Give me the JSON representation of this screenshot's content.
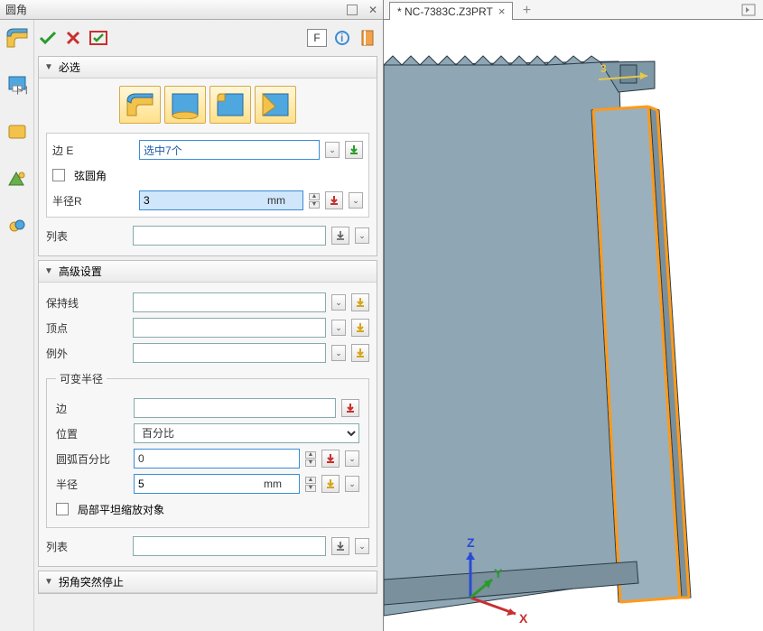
{
  "panel": {
    "title": "圆角"
  },
  "top": {
    "f_button": "F"
  },
  "tab": {
    "title": "* NC-7383C.Z3PRT",
    "close": "×",
    "add": "+"
  },
  "sec_required": {
    "title": "必选"
  },
  "req": {
    "edge_label": "边 E",
    "edge_value": "选中7个",
    "chord_label": "弦圆角",
    "radius_label": "半径R",
    "radius_value": "3",
    "radius_unit": "mm",
    "list_label": "列表"
  },
  "sec_adv": {
    "title": "高级设置"
  },
  "adv": {
    "keep_label": "保持线",
    "vertex_label": "顶点",
    "except_label": "例外"
  },
  "vr": {
    "legend": "可变半径",
    "edge_label": "边",
    "pos_label": "位置",
    "pos_value": "百分比",
    "arc_label": "圆弧百分比",
    "arc_value": "0",
    "r_label": "半径",
    "r_value": "5",
    "r_unit": "mm",
    "local_label": "局部平坦缩放对象",
    "list_label": "列表"
  },
  "sec_corner": {
    "title": "拐角突然停止"
  },
  "axes": {
    "x": "X",
    "y": "Y",
    "z": "Z"
  },
  "dim3": "3"
}
